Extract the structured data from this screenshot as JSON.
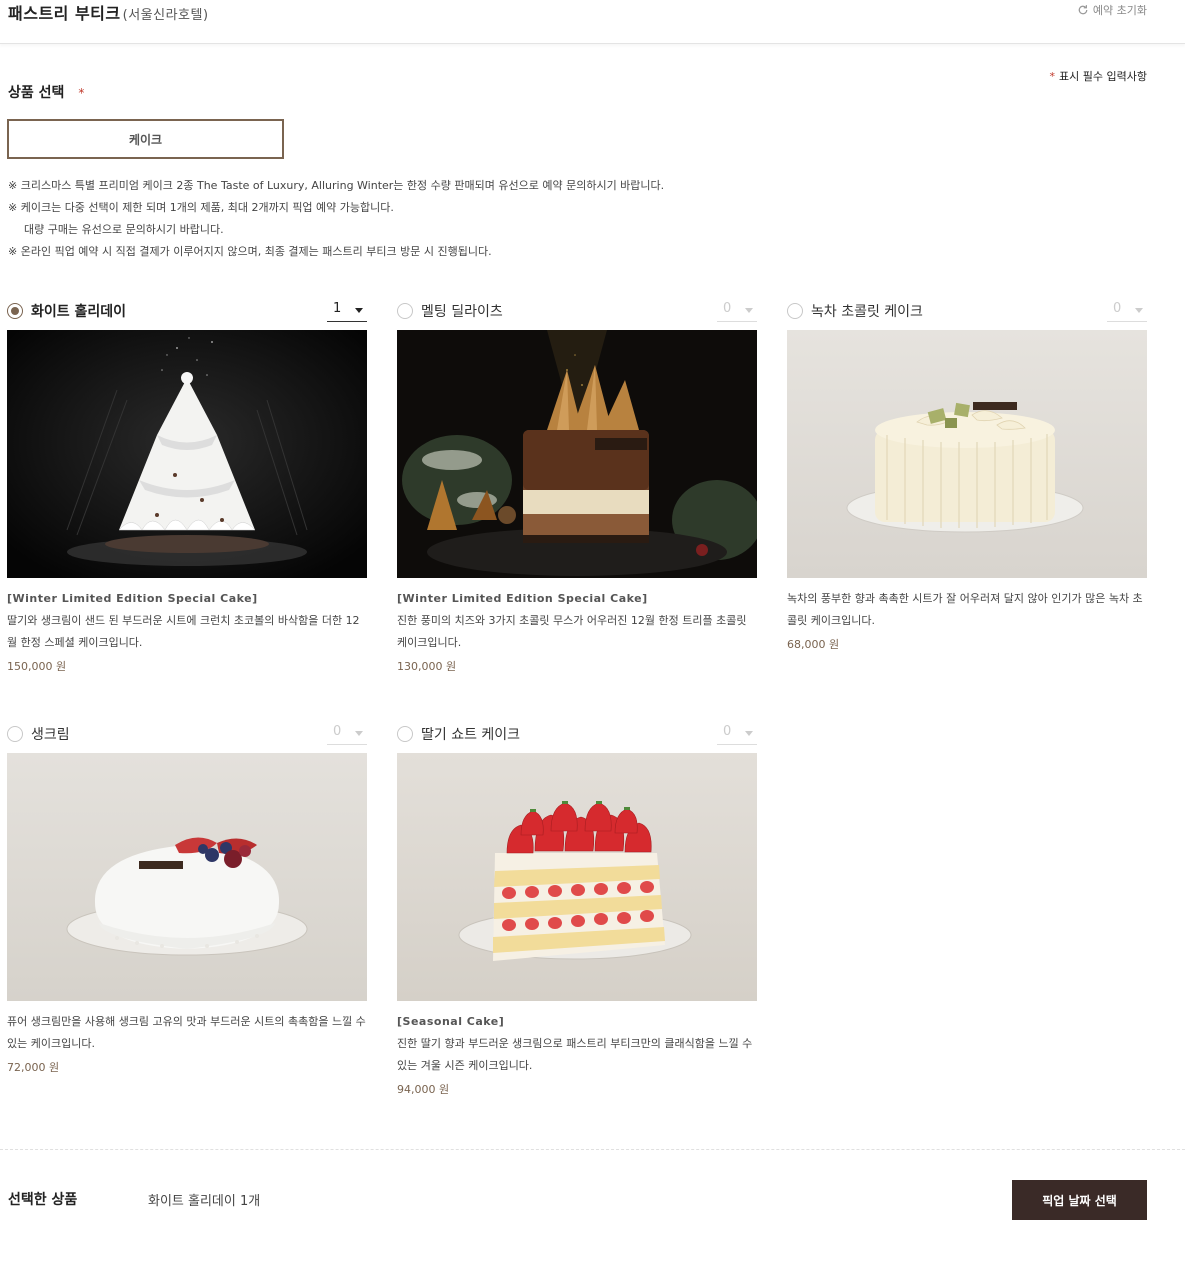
{
  "header": {
    "title": "패스트리 부티크",
    "subtitle": "(서울신라호텔)",
    "reset_label": "예약 초기화"
  },
  "required_note": "표시 필수 입력사항",
  "required_mark": "*",
  "section": {
    "title": "상품 선택",
    "category_label": "케이크"
  },
  "notices": [
    "※ 크리스마스 특별 프리미엄 케이크 2종 The Taste of Luxury, Alluring Winter는 한정 수량 판매되며 유선으로 예약 문의하시기 바랍니다.",
    "※ 케이크는 다중 선택이 제한 되며 1개의 제품, 최대 2개까지 픽업 예약 가능합니다.",
    "대량 구매는 유선으로 문의하시기 바랍니다.",
    "※ 온라인 픽업 예약 시 직접 결제가 이루어지지 않으며, 최종 결제는 패스트리 부티크 방문 시 진행됩니다."
  ],
  "products": [
    {
      "name": "화이트 홀리데이",
      "qty": "1",
      "selected": true,
      "tag": "[Winter Limited Edition Special Cake]",
      "desc": "딸기와 생크림이 샌드 된 부드러운 시트에 크런치 초코볼의 바삭함을 더한 12월 한정 스페셜 케이크입니다.",
      "price": "150,000 원"
    },
    {
      "name": "멜팅 딜라이츠",
      "qty": "0",
      "selected": false,
      "tag": "[Winter Limited Edition Special Cake]",
      "desc": "진한 풍미의 치즈와 3가지 초콜릿 무스가 어우러진 12월 한정 트리플 초콜릿 케이크입니다.",
      "price": "130,000 원"
    },
    {
      "name": "녹차 초콜릿 케이크",
      "qty": "0",
      "selected": false,
      "tag": "",
      "desc": "녹차의 풍부한 향과 촉촉한 시트가 잘 어우러져 달지 않아 인기가 많은 녹차 초콜릿 케이크입니다.",
      "price": "68,000 원"
    },
    {
      "name": "생크림",
      "qty": "0",
      "selected": false,
      "tag": "",
      "desc": "퓨어 생크림만을 사용해 생크림 고유의 맛과 부드러운 시트의 촉촉함을 느낄 수 있는 케이크입니다.",
      "price": "72,000 원"
    },
    {
      "name": "딸기 쇼트 케이크",
      "qty": "0",
      "selected": false,
      "tag": "[Seasonal Cake]",
      "desc": "진한 딸기 향과 부드러운 생크림으로 패스트리 부티크만의 클래식함을 느낄 수 있는 겨울 시즌 케이크입니다.",
      "price": "94,000 원"
    }
  ],
  "footer": {
    "selected_label": "선택한 상품",
    "selected_value": "화이트 홀리데이 1개",
    "pickup_button": "픽업 날짜 선택"
  },
  "colors": {
    "accent_brown": "#7a6450",
    "button_dark": "#3a2a27",
    "required_red": "#c0392b"
  }
}
